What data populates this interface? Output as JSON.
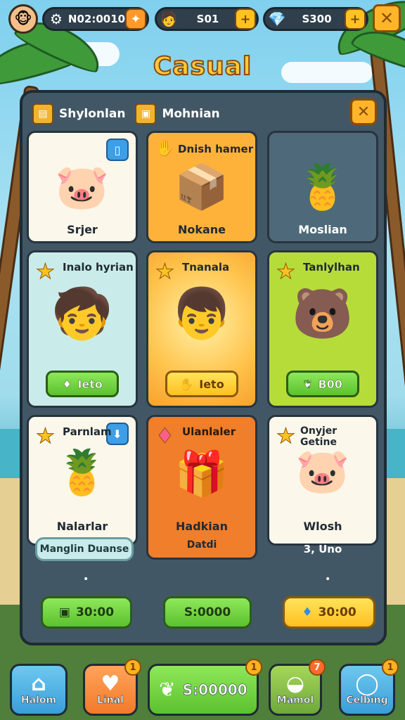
{
  "topbar": {
    "resources": [
      {
        "icon": "gear-icon",
        "value": "N02:0010"
      },
      {
        "icon": "coin-icon",
        "value": "S01"
      },
      {
        "icon": "gem-icon",
        "value": "S300"
      }
    ]
  },
  "title": "Casual",
  "panel": {
    "tabs": [
      "Shylonlan",
      "Mohnian"
    ]
  },
  "cards": [
    {
      "title": "",
      "label": "Srjer",
      "art": "🐷",
      "color": "#fbf7ea"
    },
    {
      "title": "Dnish hamer",
      "label": "Nokane",
      "art": "📦",
      "color": "#ffb23a"
    },
    {
      "title": "",
      "label": "Moslian",
      "art": "🍍",
      "color": "#4e6a7a"
    },
    {
      "title": "Inalo hyrian",
      "label": "",
      "art": "🧒",
      "button": "Ieto",
      "color": "#c9ecea"
    },
    {
      "title": "Tnanala",
      "label": "",
      "art": "👦",
      "button": "Ieto",
      "color": "#ffc24a"
    },
    {
      "title": "Tanlylhan",
      "label": "",
      "art": "🐻",
      "button": "B00",
      "color": "#b6dc3a"
    },
    {
      "title": "Parnlam",
      "label": "Nalarlar",
      "art": "🍍",
      "color": "#fbf7ea"
    },
    {
      "title": "Ulanlaler",
      "label": "Hadkian",
      "sublabel": "Datdi",
      "art": "🎁",
      "color": "#f07e2a"
    },
    {
      "title": "Onyjer Getine",
      "label": "Wlosh",
      "art": "🐷",
      "color": "#fbf7ea"
    }
  ],
  "extra_text": {
    "mangin": "Manglin Duanse",
    "below_right": "3, Uno"
  },
  "prices": [
    "30:00",
    "S:0000",
    "30:00"
  ],
  "nav": [
    {
      "label": "Halom",
      "icon": "home-icon",
      "badge": ""
    },
    {
      "label": "Linal",
      "icon": "heart-icon",
      "badge": "1"
    },
    {
      "label": "S:00000",
      "icon": "leaf-icon",
      "badge": "1"
    },
    {
      "label": "Mamol",
      "icon": "bowl-icon",
      "badge": "7"
    },
    {
      "label": "Celbing",
      "icon": "ring-icon",
      "badge": "1"
    }
  ]
}
